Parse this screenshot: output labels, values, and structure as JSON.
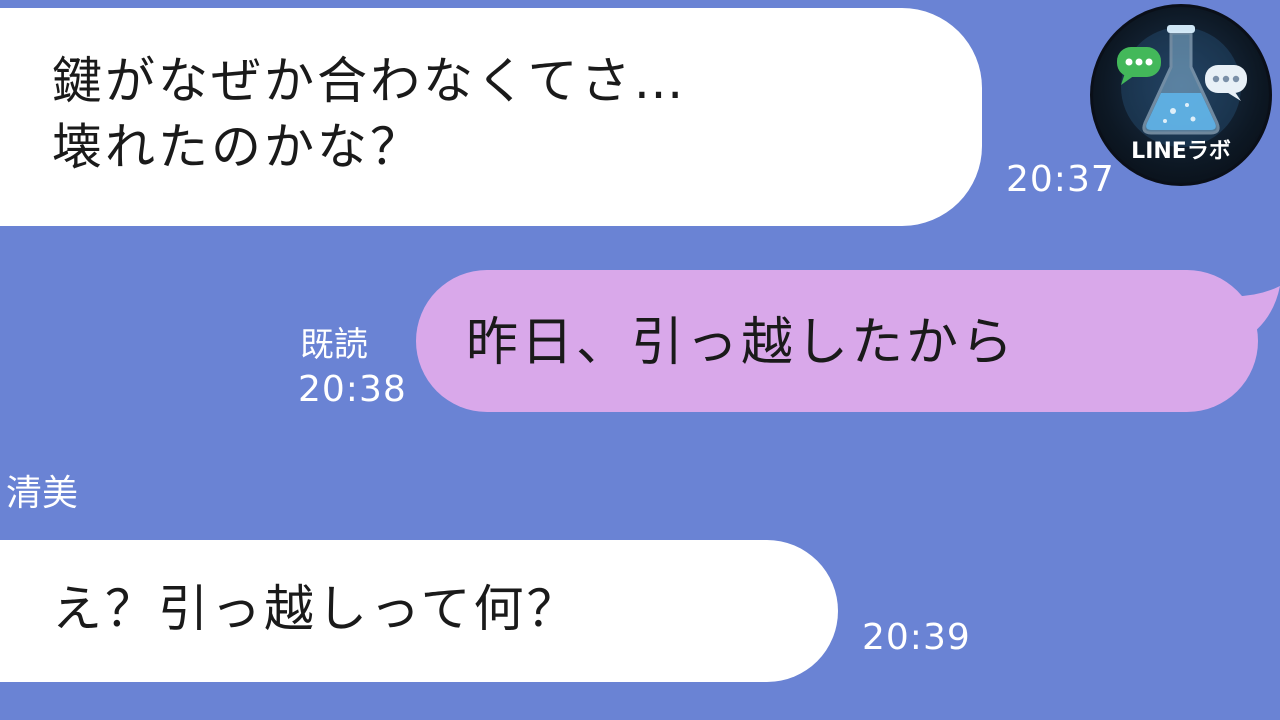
{
  "chat": {
    "messages": [
      {
        "direction": "incoming",
        "lines": [
          "鍵がなぜか合わなくてさ…",
          "壊れたのかな？"
        ],
        "time": "20:37"
      },
      {
        "direction": "outgoing",
        "lines": [
          "昨日、引っ越したから"
        ],
        "read_label": "既読",
        "time": "20:38"
      },
      {
        "direction": "incoming",
        "sender": "清美",
        "lines": [
          "え？引っ越しって何？"
        ],
        "time": "20:39"
      }
    ]
  },
  "logo": {
    "text": "LINEラボ",
    "icon": "flask-chat-icon"
  },
  "colors": {
    "background": "#6a83d4",
    "incoming_bubble": "#ffffff",
    "outgoing_bubble": "#d9a8ea",
    "meta_text": "#ffffff"
  }
}
